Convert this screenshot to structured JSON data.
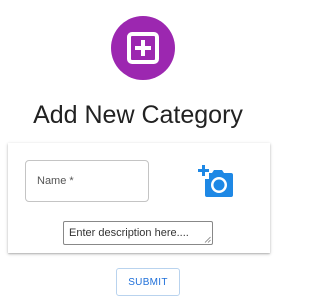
{
  "header": {
    "icon": "add-box-icon",
    "title": "Add New Category"
  },
  "form": {
    "name_label": "Name *",
    "name_value": "",
    "photo_icon": "add-a-photo-icon",
    "description_placeholder": "Enter description here....",
    "description_value": ""
  },
  "actions": {
    "submit_label": "SUBMIT"
  },
  "colors": {
    "accent_purple": "#9c27b0",
    "icon_blue": "#1e88e5",
    "button_text_blue": "#1e6fd9"
  }
}
